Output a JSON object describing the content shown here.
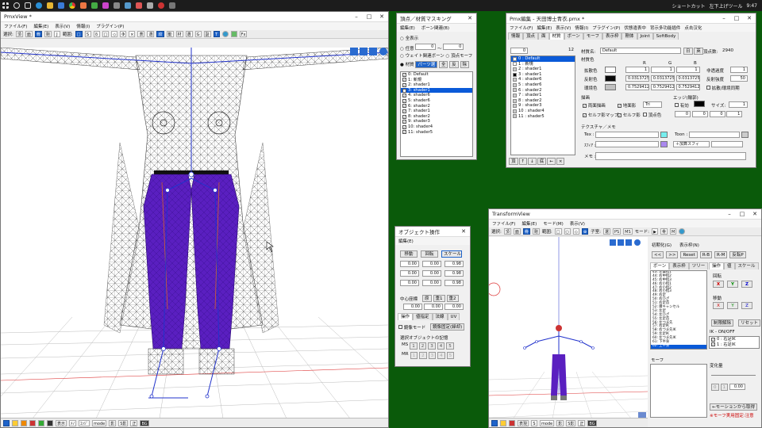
{
  "taskbar": {
    "right_label": "ショートカット",
    "right_label2": "左下上げツール",
    "clock": "9:47",
    "icons": [
      "windows-icon",
      "search-icon",
      "cortana-icon",
      "task-view-icon",
      "edge-icon",
      "explorer-icon",
      "store-icon",
      "chrome-icon",
      "app-icon",
      "app-icon",
      "app-icon",
      "app-icon",
      "app-icon",
      "app-icon",
      "app-icon",
      "app-icon",
      "app-icon"
    ]
  },
  "pmxview": {
    "title": "PmxView *",
    "menu": [
      "ファイル(F)",
      "編集(E)",
      "表示(V)",
      "情報(I)",
      "プラグイン(P)"
    ],
    "toolbar": [
      "選択:",
      "頂",
      "面",
      "骨",
      "剛",
      "J",
      "範囲:",
      "□",
      "S",
      "δ",
      "□",
      "◇",
      "Φ",
      "×",
      "表",
      "選",
      "絞",
      "動",
      "材",
      "選",
      "G",
      "副",
      "T",
      "Fx"
    ],
    "status": [
      "表示",
      "ﾒﾉ",
      "ｴｯｼﾞ",
      "mode",
      "影",
      "S影",
      "正",
      "BG"
    ]
  },
  "mask": {
    "title": "頂点／材質マスキング",
    "menu": [
      "編集(E)",
      "ボーン関連(B)"
    ],
    "opt_all": "全表示",
    "opt_any": "任意",
    "range_from": "0",
    "range_tilde": "〜",
    "range_to": "0",
    "opt_weight": "ウェイト関連ボーン",
    "opt_morph": "頂点モーフ",
    "opt_material": "材質",
    "btn_parts": "パーツ選",
    "btn_all": "全",
    "btn_inv": "反",
    "btn_del": "除",
    "items": [
      "0: Default",
      "1: 新規",
      "2: shader1",
      "3: shader1",
      "4: shader6",
      "5: shader6",
      "6: shader2",
      "7: shader1",
      "8: shader2",
      "9: shader3",
      "10: shader4",
      "11: shader5"
    ],
    "selected_index": 3
  },
  "pmx": {
    "title": "Pmx編集 - 天田博士青衣.pmx *",
    "menu": [
      "ファイル(F)",
      "編集(E)",
      "表示(V)",
      "情報(I)",
      "プラグイン(P)",
      "伏態違表中",
      "背示多功能插件",
      "点击汉化"
    ],
    "tabs": [
      "情報",
      "頂点",
      "面",
      "材質",
      "ボーン",
      "モーフ",
      "表示枠",
      "剛体",
      "Joint",
      "SoftBody"
    ],
    "active_tab": 3,
    "count": "12",
    "index": "0",
    "list": [
      "0 : Default",
      "1 : 新規",
      "2 : shader1",
      "3 : shader1",
      "4 : shader6",
      "5 : shader6",
      "6 : shader2",
      "7 : shader1",
      "8 : shader2",
      "9 : shader3",
      "10 : shader4",
      "11 : shader5"
    ],
    "selected_index": 0,
    "material_name_label": "材質名:",
    "material_name": "Default",
    "jp_btn": "日",
    "en_btn": "英",
    "vertex_count_label": "頂点数:",
    "vertex_count": "2940",
    "material_color_label": "材質色",
    "col_r": "R",
    "col_g": "G",
    "col_b": "B",
    "diffuse_label": "拡散色",
    "diffuse": [
      "1",
      "1",
      "1"
    ],
    "alpha_label": "非透過度",
    "alpha": "1",
    "specular_label": "反射色",
    "specular": [
      "0.03137255",
      "0.03137255",
      "0.03137255"
    ],
    "spec_power_label": "反射強度",
    "spec_power": "50",
    "ambient_label": "環境色",
    "ambient": [
      "0.7529412",
      "0.7529412",
      "0.7529412"
    ],
    "ambient_scale_label": "拡散/環境同期",
    "draw_label": "描画",
    "edge_label": "エッジ(輪郭)",
    "double_sided": "両面描画",
    "ground_shadow": "地面影",
    "tri_value": "Tri",
    "self_shadow_map": "セルフ影マップ",
    "self_shadow": "セルフ影",
    "vertex_color": "頂点色",
    "edge_enabled": "有効",
    "edge_size_label": "サイズ:",
    "edge_size": "1",
    "edge_rgba": [
      "0",
      "0",
      "0",
      "1"
    ],
    "texture_label": "テクスチャ／メモ",
    "tex_label": "Tex :",
    "toon_label": "Toon :",
    "sphere_label": "ｽﾌｨｱ :",
    "sphere_mode": "＋加算スフィ",
    "memo_label": "メモ :",
    "nav": [
      "頂",
      "↑",
      "↓",
      "底",
      "←",
      "×"
    ]
  },
  "objop": {
    "title": "オブジェクト操作",
    "menu": "編集(E)",
    "btn_move": "移動",
    "btn_rotate": "回転",
    "btn_scale": "スケール",
    "rows": [
      [
        "0.00",
        "0.00",
        "0.98"
      ],
      [
        "0.00",
        "0.00",
        "0.98"
      ],
      [
        "0.00",
        "0.00",
        "0.98"
      ]
    ],
    "center_label": "中心座標",
    "btn_origin": "原",
    "btn_center1": "重1",
    "btn_center2": "重2",
    "center": [
      "0.00",
      "0.00",
      "0.00"
    ],
    "tabs": [
      "操作",
      "値指定",
      "法線",
      "UV"
    ],
    "mirror_mode": "鏡像モード",
    "mirror_fix": "鏡像固定(繰却)",
    "memory_label": "選択オブジェクトの記憶",
    "ms": "MS",
    "mr": "MR",
    "slots": [
      "1",
      "2",
      "3",
      "4",
      "5"
    ]
  },
  "transform": {
    "title": "TransformView",
    "menu": [
      "ファイル(F)",
      "編集(E)",
      "モード(M)",
      "表示(V)"
    ],
    "toolbar": [
      "選択:",
      "頂",
      "面",
      "骨",
      "剛",
      "範囲:",
      "子室:",
      "選",
      "PS",
      "MS",
      "モード:",
      "▶",
      "骨",
      "M"
    ],
    "pose_menu": [
      "初期化(G)",
      "表示枠(N)"
    ],
    "btn_prev": "<<",
    "btn_next": ">>",
    "btn_reset": "Reset",
    "btn_rb": "R-B",
    "btn_rm": "R-M",
    "btn_invert": "反転P",
    "sub_tabs": [
      "ボーン",
      "表示枠",
      "ツリー"
    ],
    "op_tabs": [
      "操作",
      "値",
      "スケール"
    ],
    "bones": [
      "43: 左薬指1",
      "44: 右中指2",
      "45: 右中指3",
      "46: 右小指1",
      "47: 右小指2",
      "48: 右小指3",
      "49: 右足",
      "50: 右ひざ",
      "51: 右足首",
      "52: 腰キャンセル",
      "53: 左足",
      "54: 左ひざ",
      "55: 左足首",
      "56: 左つま先",
      "57: 右足IK",
      "58: 右つま先IK",
      "59: 左足IK",
      "60: 左つま先IK",
      "61: 下半身",
      "62: 上半身"
    ],
    "selected_bone": 19,
    "rotate_label": "回転",
    "x": "X",
    "y": "Y",
    "z": "Z",
    "move_label": "移動",
    "limit_release": "制限解除",
    "reset": "リセット",
    "ik_label": "IK - ON/OFF",
    "ik_items": [
      "0 : 右足IK",
      "1 : 右足IK"
    ],
    "morph_label": "モーフ",
    "change_label": "変化量",
    "change_value": "0.00",
    "pose_from_morph": "←モーションから取得",
    "note": "※モーフ実用固定:注意",
    "status": [
      "表現",
      "S",
      "mode",
      "影",
      "S影",
      "正",
      "BG"
    ]
  },
  "colors": {
    "desktop": "#0a5a0a",
    "selection": "#0a5ad8",
    "bone": "#2233cc",
    "pants": "#5a1fc0"
  }
}
